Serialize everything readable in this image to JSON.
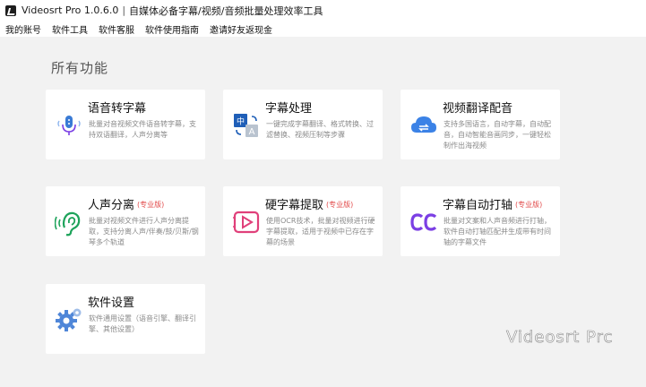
{
  "window": {
    "app_name": "Videosrt Pro 1.0.6.0",
    "separator": "|",
    "subtitle": "自媒体必备字幕/视频/音频批量处理效率工具"
  },
  "menu": [
    {
      "label": "我的账号"
    },
    {
      "label": "软件工具"
    },
    {
      "label": "软件客服"
    },
    {
      "label": "软件使用指南"
    },
    {
      "label": "邀请好友返现金"
    }
  ],
  "section_title": "所有功能",
  "cards": [
    {
      "title": "语音转字幕",
      "badge": "",
      "desc": "批量对音视频文件语音转字幕，支持双语翻译，人声分离等",
      "icon": "microphone-icon"
    },
    {
      "title": "字幕处理",
      "badge": "",
      "desc": "一键完成字幕翻译、格式转换、过滤替换、视频压制等步骤",
      "icon": "translate-icon"
    },
    {
      "title": "视频翻译配音",
      "badge": "",
      "desc": "支持多国语言，自动字幕，自动配音，自动智能音画同步，一键轻松制作出海视频",
      "icon": "cloud-sync-icon"
    },
    {
      "title": "人声分离",
      "badge": "(专业版)",
      "desc": "批量对视频文件进行人声分离提取，支持分离人声/伴奏/鼓/贝斯/钢琴多个轨道",
      "icon": "ear-icon"
    },
    {
      "title": "硬字幕提取",
      "badge": "(专业版)",
      "desc": "使用OCR技术，批量对视频进行硬字幕提取，适用于视频中已存在字幕的场景",
      "icon": "video-play-icon"
    },
    {
      "title": "字幕自动打轴",
      "badge": "(专业版)",
      "desc": "批量对文案和人声音频进行打轴，软件自动打轴匹配并生成带有时间轴的字幕文件",
      "icon": "cc-icon"
    },
    {
      "title": "软件设置",
      "badge": "",
      "desc": "软件通用设置（语音引擎、翻译引擎、其他设置）",
      "icon": "gear-icon"
    }
  ],
  "colors": {
    "accent_blue": "#3a7bd5",
    "badge_red": "#e24a4a",
    "purple": "#7b3fe4",
    "green": "#2bb673",
    "pink": "#e0407a"
  },
  "watermark": "Videosrt Prc"
}
